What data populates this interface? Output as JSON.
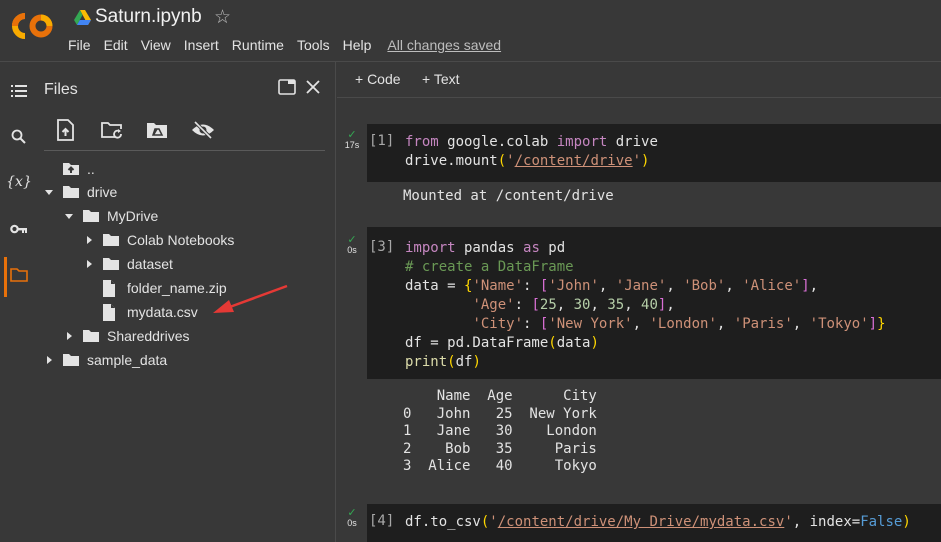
{
  "header": {
    "app_name": "Colab",
    "title": "Saturn.ipynb",
    "menu": [
      "File",
      "Edit",
      "View",
      "Insert",
      "Runtime",
      "Tools",
      "Help"
    ],
    "save_status": "All changes saved"
  },
  "activity_bar": {
    "items": [
      {
        "icon": "table-of-contents-icon",
        "label": "Table of contents"
      },
      {
        "icon": "search-icon",
        "label": "Find and replace"
      },
      {
        "icon": "variables-icon",
        "label": "{x}"
      },
      {
        "icon": "key-icon",
        "label": "Secrets"
      },
      {
        "icon": "folder-icon",
        "label": "Files",
        "active": true
      }
    ]
  },
  "files_panel": {
    "title": "Files",
    "toolbar": [
      {
        "icon": "upload-file-icon",
        "label": "Upload to session storage"
      },
      {
        "icon": "refresh-folder-icon",
        "label": "Refresh"
      },
      {
        "icon": "mount-drive-icon",
        "label": "Mount Drive"
      },
      {
        "icon": "hide-files-icon",
        "label": "Toggle hidden files"
      }
    ],
    "tree": [
      {
        "label": "..",
        "type": "parent",
        "depth": 0
      },
      {
        "label": "drive",
        "type": "folder",
        "depth": 0,
        "expanded": true
      },
      {
        "label": "MyDrive",
        "type": "folder",
        "depth": 1,
        "expanded": true
      },
      {
        "label": "Colab Notebooks",
        "type": "folder",
        "depth": 2,
        "expanded": false
      },
      {
        "label": "dataset",
        "type": "folder",
        "depth": 2,
        "expanded": false
      },
      {
        "label": "folder_name.zip",
        "type": "file",
        "depth": 2
      },
      {
        "label": "mydata.csv",
        "type": "file",
        "depth": 2,
        "annotated": true
      },
      {
        "label": "Shareddrives",
        "type": "folder",
        "depth": 1,
        "expanded": false
      },
      {
        "label": "sample_data",
        "type": "folder",
        "depth": 0,
        "expanded": false
      }
    ],
    "annotation_color": "#e53935"
  },
  "notebook": {
    "toolbar": {
      "add_code": "+ Code",
      "add_text": "+ Text"
    },
    "cells": [
      {
        "exec_count": "[1]",
        "duration": "17s",
        "status": "success",
        "code": [
          "from google.colab import drive",
          "drive.mount('/content/drive')"
        ],
        "output": [
          "Mounted at /content/drive"
        ]
      },
      {
        "exec_count": "[3]",
        "duration": "0s",
        "status": "success",
        "code": [
          "import pandas as pd",
          "# create a DataFrame",
          "data = {'Name': ['John', 'Jane', 'Bob', 'Alice'],",
          "        'Age': [25, 30, 35, 40],",
          "        'City': ['New York', 'London', 'Paris', 'Tokyo']}",
          "df = pd.DataFrame(data)",
          "print(df)"
        ],
        "output": [
          "    Name  Age      City",
          "0   John   25  New York",
          "1   Jane   30    London",
          "2    Bob   35     Paris",
          "3  Alice   40     Tokyo"
        ]
      },
      {
        "exec_count": "[4]",
        "duration": "0s",
        "status": "success",
        "code": [
          "df.to_csv('/content/drive/My Drive/mydata.csv', index=False)"
        ],
        "output": []
      }
    ],
    "code_tokens": {
      "c1_from": "from",
      "c1_mod": " google.colab ",
      "c1_import": "import",
      "c1_drive": " drive",
      "c1_l2a": "drive.mount",
      "c1_po": "(",
      "c1_q1": "'",
      "c1_path": "/content/drive",
      "c1_q2": "'",
      "c1_pc": ")",
      "c3_import": "import",
      "c3_pandas": " pandas ",
      "c3_as": "as",
      "c3_pd": " pd",
      "c3_comment": "# create a DataFrame",
      "c3_data": "data = ",
      "c3_brace": "{",
      "c3_name": "'Name'",
      "c3_colon": ": ",
      "c3_lb": "[",
      "c3_john": "'John'",
      "c3_jane": "'Jane'",
      "c3_bob": "'Bob'",
      "c3_alice": "'Alice'",
      "c3_rb": "]",
      "c3_comma": ",",
      "c3_pad": "        ",
      "c3_age": "'Age'",
      "c3_n25": "25",
      "c3_n30": "30",
      "c3_n35": "35",
      "c3_n40": "40",
      "c3_city": "'City'",
      "c3_ny": "'New York'",
      "c3_lon": "'London'",
      "c3_par": "'Paris'",
      "c3_tok": "'Tokyo'",
      "c3_rbrace": "}",
      "c3_df": "df = pd.DataFrame",
      "c3_dfarg": "data",
      "c3_print": "print",
      "c3_printarg": "df",
      "c4_a": "df.to_csv",
      "c4_path": "/content/drive/My Drive/mydata.csv",
      "c4_idx": ", index=",
      "c4_false": "False"
    }
  },
  "colors": {
    "accent": "#e8710a",
    "success": "#34a853",
    "background": "#383838",
    "cell_background": "#1e1e1e"
  }
}
